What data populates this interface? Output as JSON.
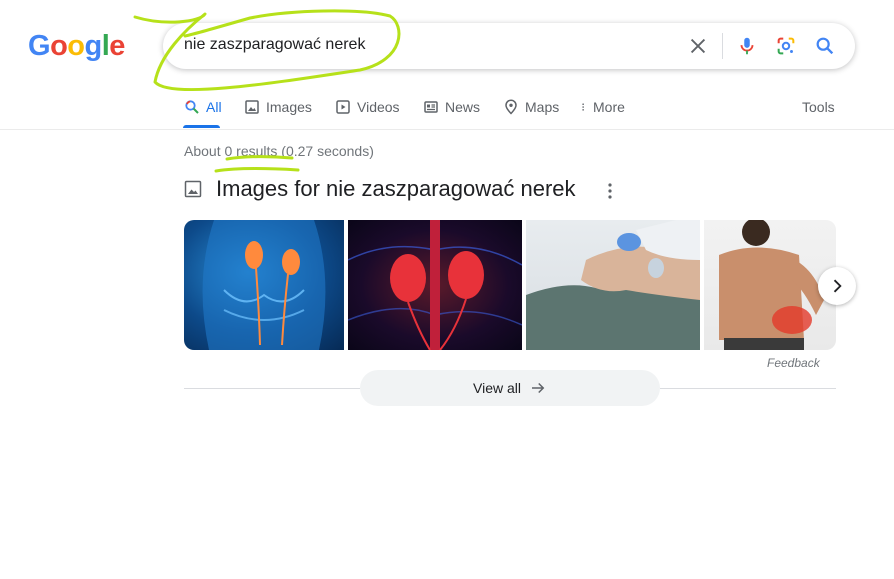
{
  "logo": {
    "text": "Google"
  },
  "search": {
    "query": "nie zaszparagować nerek"
  },
  "tabs": [
    {
      "label": "All"
    },
    {
      "label": "Images"
    },
    {
      "label": "Videos"
    },
    {
      "label": "News"
    },
    {
      "label": "Maps"
    },
    {
      "label": "More"
    }
  ],
  "tools_label": "Tools",
  "result_stats": "About 0 results (0.27 seconds)",
  "images_section": {
    "title": "Images for nie zaszparagować nerek",
    "feedback_label": "Feedback",
    "view_all_label": "View all"
  },
  "colors": {
    "accent": "#1a73e8",
    "annotation": "#b6e11a",
    "logo_blue": "#4285f4",
    "logo_red": "#ea4335",
    "logo_yellow": "#fbbc05",
    "logo_green": "#34a853"
  },
  "icons": [
    "close-icon",
    "microphone-icon",
    "google-lens-icon",
    "search-icon",
    "chevron-right-icon",
    "arrow-right-icon",
    "image-icon",
    "more-vert-icon"
  ]
}
